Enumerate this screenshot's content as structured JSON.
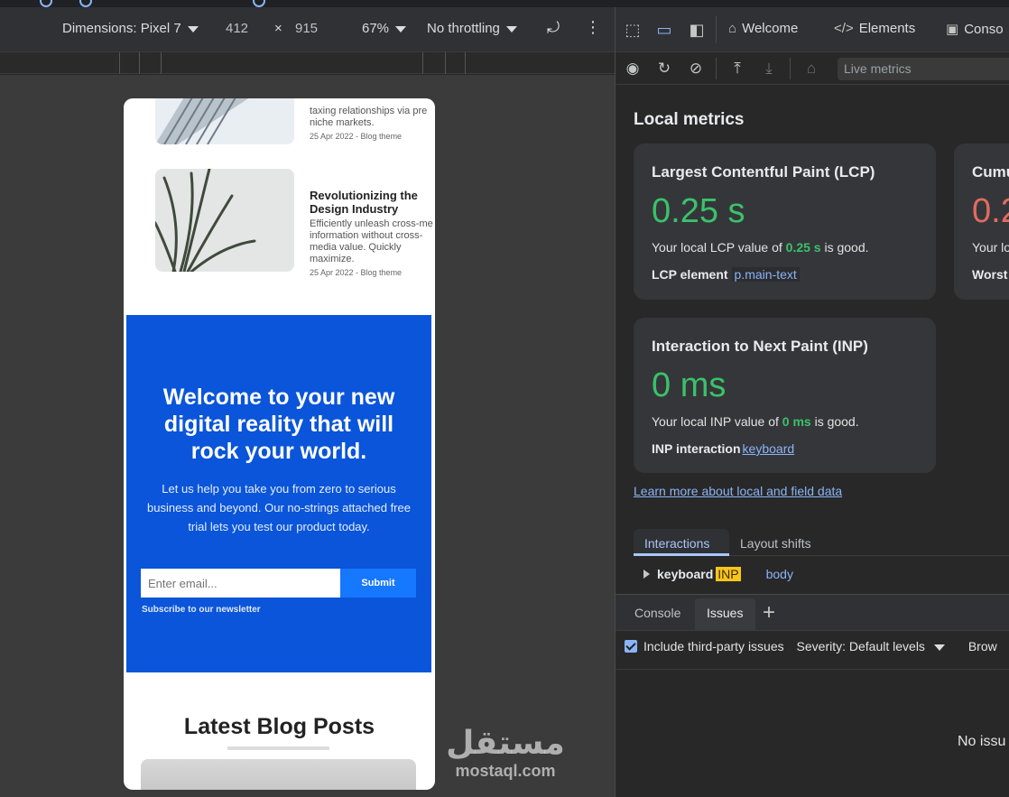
{
  "device_toolbar": {
    "dimensions_label": "Dimensions: Pixel 7",
    "width": "412",
    "times": "×",
    "height": "915",
    "zoom": "67%",
    "throttling": "No throttling"
  },
  "page": {
    "post1": {
      "excerpt_partial": "taxing relationships via pre niche markets.",
      "meta": "25 Apr 2022 - Blog theme"
    },
    "post2": {
      "title": "Revolutionizing the Design Industry",
      "excerpt": "Efficiently unleash cross-me information without cross-media value. Quickly maximize.",
      "meta": "25 Apr 2022 - Blog theme"
    },
    "hero": {
      "heading": "Welcome to your new digital reality that will rock your world.",
      "text": "Let us help you take you from zero to serious business and beyond. Our no-strings attached free trial lets you test our product today.",
      "email_placeholder": "Enter email...",
      "submit_label": "Submit",
      "note": "Subscribe to our newsletter"
    },
    "latest_title": "Latest Blog Posts"
  },
  "watermark": {
    "arabic": "مستقل",
    "latin": "mostaql.com"
  },
  "devtools": {
    "tabs": {
      "welcome": "Welcome",
      "elements": "Elements",
      "console": "Conso"
    },
    "live_metrics_placeholder": "Live metrics",
    "local_metrics_title": "Local metrics",
    "lcp": {
      "title": "Largest Contentful Paint (LCP)",
      "value": "0.25 s",
      "desc_prefix": "Your local LCP value of ",
      "desc_value": "0.25 s",
      "desc_suffix": " is good.",
      "element_label": "LCP element",
      "element_value": "p.main-text"
    },
    "cls_partial": {
      "title": "Cumu",
      "value": "0.2",
      "desc": "Your lo",
      "worst": "Worst"
    },
    "inp": {
      "title": "Interaction to Next Paint (INP)",
      "value": "0 ms",
      "desc_prefix": "Your local INP value of ",
      "desc_value": "0 ms",
      "desc_suffix": " is good.",
      "interaction_label": "INP interaction",
      "interaction_value": "keyboard"
    },
    "learn_more": "Learn more about local and field data",
    "sub_tabs": {
      "interactions": "Interactions",
      "layout_shifts": "Layout shifts"
    },
    "interaction_row": {
      "type": "keyboard",
      "badge": "INP",
      "target": "body"
    },
    "drawer": {
      "console_tab": "Console",
      "issues_tab": "Issues",
      "include_third_party": "Include third-party issues",
      "severity": "Severity: Default levels",
      "browser_partial": "Brow",
      "no_issues": "No issu"
    }
  }
}
